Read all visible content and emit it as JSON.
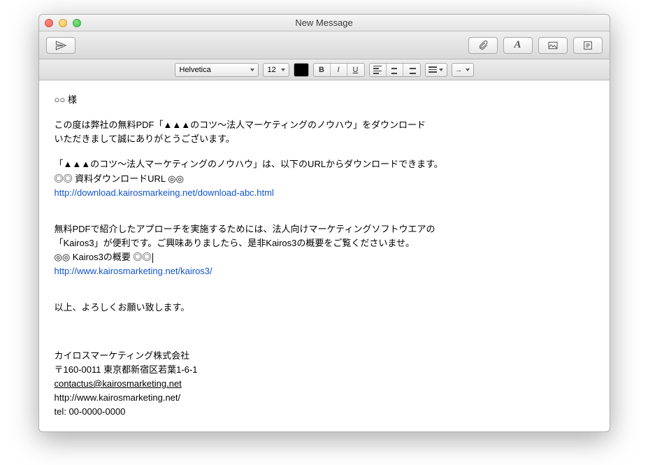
{
  "window": {
    "title": "New Message"
  },
  "format": {
    "font": "Helvetica",
    "size": "12",
    "bold": "B",
    "italic": "I",
    "underline": "U"
  },
  "body": {
    "greeting": "○○ 様",
    "p1_l1": "この度は弊社の無料PDF「▲▲▲のコツ〜法人マーケティングのノウハウ」をダウンロード",
    "p1_l2": "いただきまして誠にありがとうございます。",
    "p2_l1": "「▲▲▲のコツ〜法人マーケティングのノウハウ」は、以下のURLからダウンロードできます。",
    "p2_l2": "◎◎ 資料ダウンロードURL ◎◎",
    "link1": "http://download.kairosmarkeing.net/download-abc.html",
    "p3_l1": "無料PDFで紹介したアプローチを実施するためには、法人向けマーケティングソフトウエアの",
    "p3_l2": "「Kairos3」が便利です。ご興味ありましたら、是非Kairos3の概要をご覧くださいませ。",
    "p3_l3": "◎◎ Kairos3の概要 ◎◎",
    "link2": "http://www.kairosmarketing.net/kairos3/",
    "closing": "以上、よろしくお願い致します。",
    "sig_company": "カイロスマーケティング株式会社",
    "sig_address": "〒160-0011 東京都新宿区若葉1-6-1",
    "sig_email": "contactus@kairosmarketing.net",
    "sig_url": "http://www.kairosmarketing.net/",
    "sig_tel": "tel: 00-0000-0000"
  }
}
